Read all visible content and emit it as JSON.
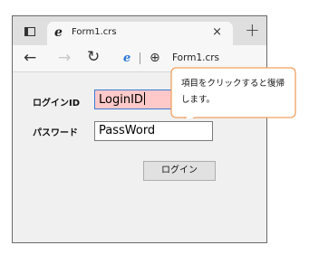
{
  "browser": {
    "tab": {
      "favicon": "edge-e-icon",
      "title": "Form1.crs",
      "close_glyph": "×"
    },
    "new_tab_glyph": "+",
    "nav": {
      "back_glyph": "←",
      "forward_glyph": "→",
      "refresh_glyph": "↻"
    },
    "address": {
      "favicon_glyph": "e",
      "globe_glyph": "⊕",
      "url": "Form1.crs"
    }
  },
  "form": {
    "login_label": "ログインID",
    "login_value": "LoginID",
    "password_label": "パスワード",
    "password_value": "PassWord",
    "login_button": "ログイン"
  },
  "callout": {
    "text": "項目をクリックすると復帰します。",
    "border_color": "#f0a060"
  },
  "colors": {
    "focused_field_bg": "#ffc9c9",
    "focused_field_border": "#3a7bd5"
  }
}
